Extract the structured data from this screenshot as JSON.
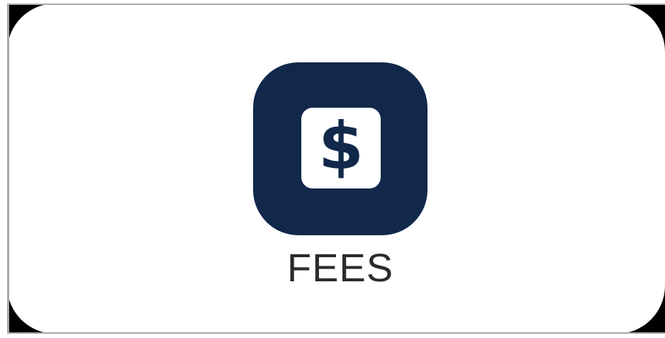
{
  "tile": {
    "icon": "dollar-icon",
    "glyph": "$",
    "label": "FEES",
    "tile_color": "#11284b",
    "badge_color": "#ffffff",
    "label_color": "#2b2b2b"
  },
  "frame": {
    "background": "#ffffff",
    "corner_color": "#000000",
    "edge_color": "#a9a9a9"
  }
}
